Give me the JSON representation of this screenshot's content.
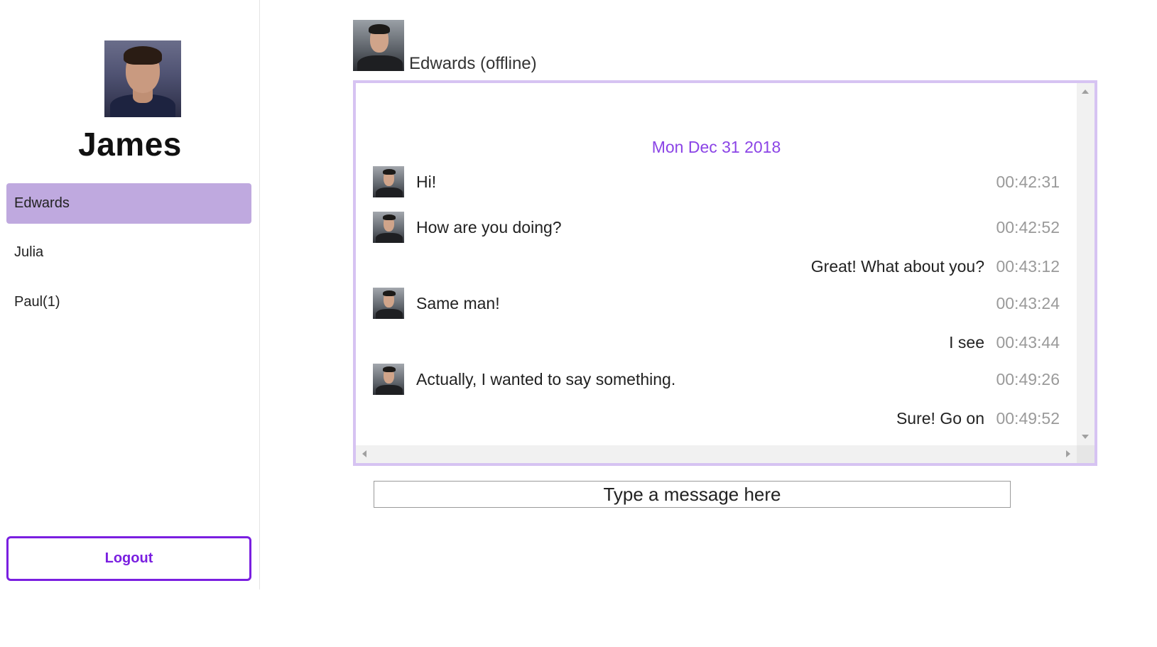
{
  "user": {
    "name": "James"
  },
  "contacts": [
    {
      "label": "Edwards",
      "active": true
    },
    {
      "label": "Julia",
      "active": false
    },
    {
      "label": "Paul(1)",
      "active": false
    }
  ],
  "logout_label": "Logout",
  "chat": {
    "peer_title": "Edwards (offline)",
    "date_label": "Mon Dec 31 2018",
    "messages": [
      {
        "direction": "in",
        "text": "Hi!",
        "time": "00:42:31"
      },
      {
        "direction": "in",
        "text": "How are you doing?",
        "time": "00:42:52"
      },
      {
        "direction": "out",
        "text": "Great! What about you?",
        "time": "00:43:12"
      },
      {
        "direction": "in",
        "text": "Same man!",
        "time": "00:43:24"
      },
      {
        "direction": "out",
        "text": "I see",
        "time": "00:43:44"
      },
      {
        "direction": "in",
        "text": "Actually, I wanted to say something.",
        "time": "00:49:26"
      },
      {
        "direction": "out",
        "text": "Sure! Go on",
        "time": "00:49:52"
      }
    ]
  },
  "composer": {
    "placeholder": "Type a message here"
  },
  "colors": {
    "accent": "#7a1fe0",
    "active_contact": "#bfa9df",
    "chat_border": "#d6c3f2",
    "date": "#8b44e6"
  }
}
